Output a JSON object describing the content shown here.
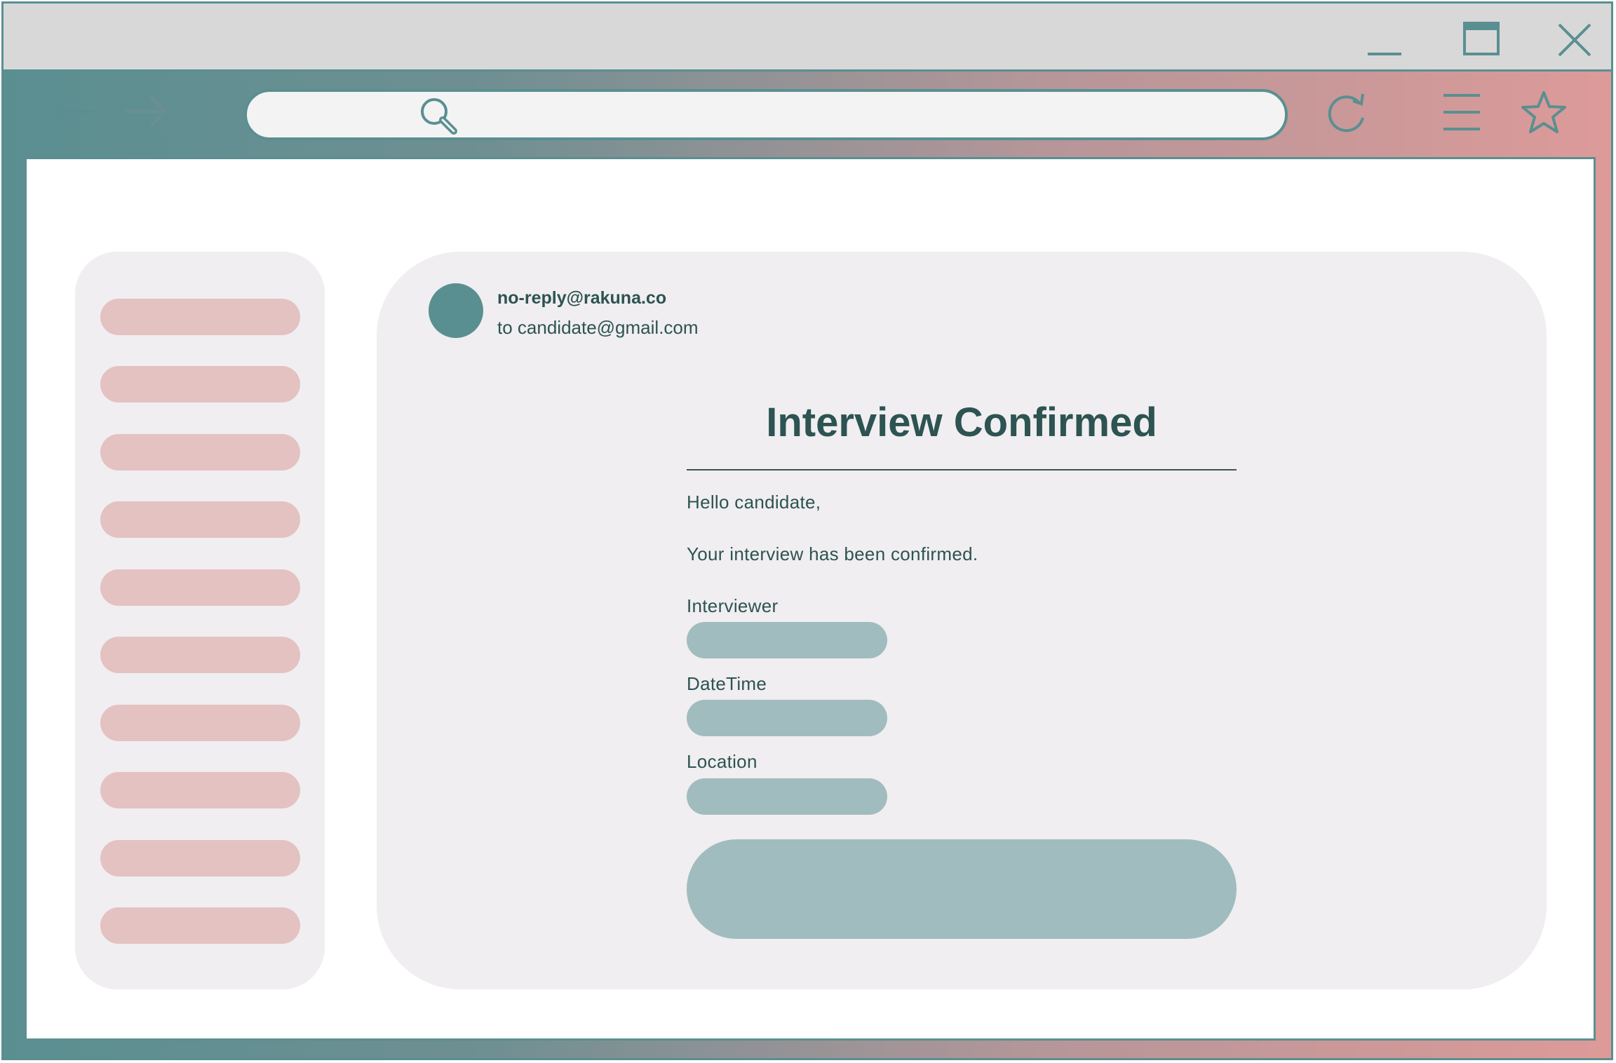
{
  "colors": {
    "accent": "#5a8f91",
    "accent_light": "#a0bcbe",
    "pink": "#e4c2c2",
    "panel": "#f0eef0",
    "text": "#2d5352",
    "gradient_end": "#dd9a99"
  },
  "window": {
    "icons": [
      "minimize-icon",
      "maximize-icon",
      "close-icon"
    ]
  },
  "toolbar": {
    "icons": [
      "back-arrow-icon",
      "forward-arrow-icon",
      "search-icon",
      "reload-icon",
      "menu-icon",
      "star-icon"
    ],
    "address_value": ""
  },
  "sidebar": {
    "item_count": 10
  },
  "email": {
    "sender": "no-reply@rakuna.co",
    "recipient": "to candidate@gmail.com",
    "title": "Interview Confirmed",
    "greeting": "Hello candidate,",
    "message": "Your interview has been confirmed.",
    "fields": [
      {
        "label": "Interviewer"
      },
      {
        "label": "DateTime"
      },
      {
        "label": "Location"
      }
    ]
  }
}
